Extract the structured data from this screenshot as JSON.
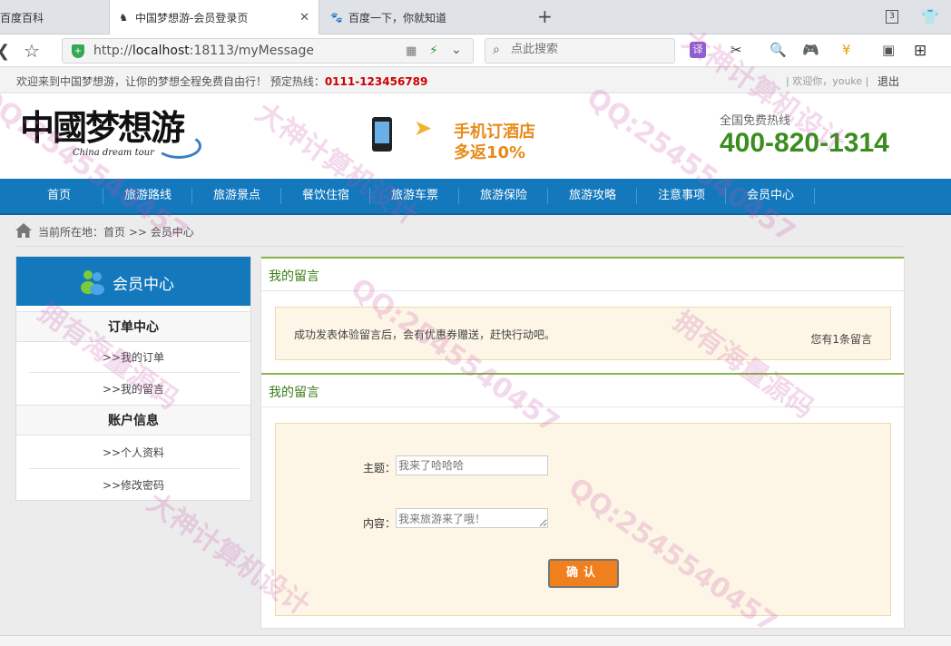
{
  "browser": {
    "tabs": [
      {
        "title": "百度百科",
        "active": false
      },
      {
        "title": "中国梦想游-会员登录页",
        "active": true
      },
      {
        "title": "百度一下，你就知道",
        "active": false
      }
    ],
    "new_tab": "+",
    "tab_count": "3",
    "url_scheme": "http://",
    "url_host": "localhost",
    "url_rest": ":18113/myMessage",
    "search_placeholder": "点此搜索",
    "translate_label": "译"
  },
  "topbar": {
    "welcome": "欢迎来到中国梦想游，让你的梦想全程免费自由行！ 预定热线：",
    "hotline": "0111-123456789",
    "user": "| 欢迎你，youke |",
    "logout": "退出"
  },
  "header": {
    "logo_cn": "中國梦想游",
    "logo_en": "China dream tour",
    "promo_line1": "手机订酒店",
    "promo_line2": "多返10%",
    "hotline_label": "全国免费热线",
    "hotline_number": "400-820-1314"
  },
  "nav": {
    "items": [
      "首页",
      "旅游路线",
      "旅游景点",
      "餐饮住宿",
      "旅游车票",
      "旅游保险",
      "旅游攻略",
      "注意事项",
      "会员中心"
    ]
  },
  "breadcrumb": {
    "text": "当前所在地：首页 >> 会员中心"
  },
  "sidebar": {
    "title": "会员中心",
    "groups": [
      {
        "title": "订单中心",
        "links": [
          ">>我的订单",
          ">>我的留言"
        ]
      },
      {
        "title": "账户信息",
        "links": [
          ">>个人资料",
          ">>修改密码"
        ]
      }
    ]
  },
  "main": {
    "section1_title": "我的留言",
    "notice_text": "成功发表体验留言后，会有优惠券赠送，赶快行动吧。",
    "notice_count": "您有1条留言",
    "section2_title": "我的留言",
    "subject_label": "主题：",
    "subject_placeholder": "我来了哈哈哈",
    "content_label": "内容：",
    "content_placeholder": "我来旅游来了哦！",
    "submit_label": "确认"
  },
  "watermarks": [
    "大神计算机设计",
    "QQ:2545540457",
    "拥有海量源码"
  ],
  "colors": {
    "nav_blue": "#1478bd",
    "accent_green": "#3a8d1e",
    "hotline_red": "#cc0000",
    "submit_orange": "#f07f1d",
    "panel_cream": "#fdf6e6"
  }
}
